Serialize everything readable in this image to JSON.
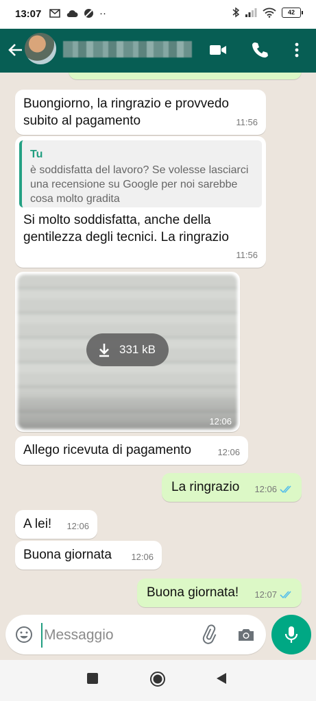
{
  "status_bar": {
    "time": "13:07",
    "battery": "42"
  },
  "header": {
    "contact_name": "",
    "accent": "#075e54"
  },
  "messages": [
    {
      "id": "m0",
      "direction": "incoming",
      "text": "Buongiorno, la ringrazio e provvedo subito al pagamento",
      "time": "11:56"
    },
    {
      "id": "m1",
      "direction": "incoming",
      "quote": {
        "author": "Tu",
        "text": "è soddisfatta del lavoro? Se volesse lasciarci una recensione su Google per noi sarebbe cosa molto gradita"
      },
      "text": "Si molto soddisfatta, anche della gentilezza degli tecnici. La ringrazio",
      "time": "11:56"
    },
    {
      "id": "m2",
      "direction": "incoming",
      "type": "image",
      "download_size": "331 kB",
      "time": "12:06"
    },
    {
      "id": "m3",
      "direction": "incoming",
      "text": "Allego ricevuta di pagamento",
      "time": "12:06"
    },
    {
      "id": "m4",
      "direction": "outgoing",
      "text": "La ringrazio",
      "time": "12:06",
      "status": "read"
    },
    {
      "id": "m5",
      "direction": "incoming",
      "text": "A lei!",
      "time": "12:06"
    },
    {
      "id": "m6",
      "direction": "incoming",
      "text": "Buona giornata",
      "time": "12:06"
    },
    {
      "id": "m7",
      "direction": "outgoing",
      "text": "Buona giornata!",
      "time": "12:07",
      "status": "read"
    }
  ],
  "composer": {
    "placeholder": "Messaggio",
    "value": ""
  },
  "colors": {
    "outgoing_bubble": "#dcf8c6",
    "incoming_bubble": "#ffffff",
    "chat_background": "#ece5dd",
    "mic_button": "#00a884",
    "read_ticks": "#53bdeb"
  }
}
